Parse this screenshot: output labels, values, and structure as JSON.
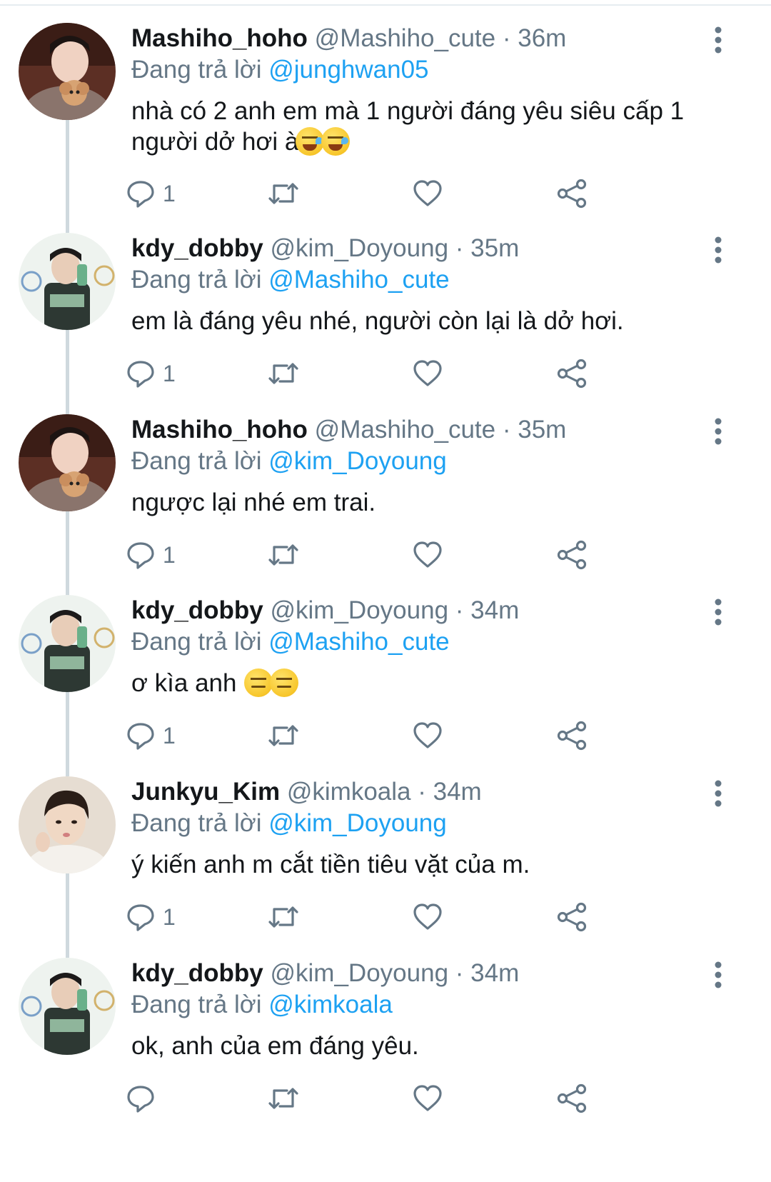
{
  "tweets": [
    {
      "display_name": "Mashiho_hoho",
      "handle": "@Mashiho_cute",
      "time": "· 36m",
      "reply_prefix": "Đang trả lời",
      "reply_to": "@junghwan05",
      "text": "nhà có 2 anh em mà 1 người đáng yêu siêu cấp 1 người dở hơi à",
      "emoji": [
        "rolling-on-floor-laughing",
        "rolling-on-floor-laughing"
      ],
      "reply_count": "1",
      "avatar": "mashiho-avatar"
    },
    {
      "display_name": "kdy_dobby",
      "handle": "@kim_Doyoung",
      "time": "· 35m",
      "reply_prefix": "Đang trả lời",
      "reply_to": "@Mashiho_cute",
      "text": "em là đáng yêu nhé, người còn lại là dở hơi.",
      "emoji": [],
      "reply_count": "1",
      "avatar": "doyoung-avatar"
    },
    {
      "display_name": "Mashiho_hoho",
      "handle": "@Mashiho_cute",
      "time": "· 35m",
      "reply_prefix": "Đang trả lời",
      "reply_to": "@kim_Doyoung",
      "text": "ngược lại nhé em trai.",
      "emoji": [],
      "reply_count": "1",
      "avatar": "mashiho-avatar"
    },
    {
      "display_name": "kdy_dobby",
      "handle": "@kim_Doyoung",
      "time": "· 34m",
      "reply_prefix": "Đang trả lời",
      "reply_to": "@Mashiho_cute",
      "text": "ơ kìa anh",
      "emoji": [
        "expressionless-face",
        "expressionless-face"
      ],
      "reply_count": "1",
      "avatar": "doyoung-avatar"
    },
    {
      "display_name": "Junkyu_Kim",
      "handle": "@kimkoala",
      "time": "· 34m",
      "reply_prefix": "Đang trả lời",
      "reply_to": "@kim_Doyoung",
      "text": "ý kiến anh m cắt tiền tiêu vặt của m.",
      "emoji": [],
      "reply_count": "1",
      "avatar": "junkyu-avatar"
    },
    {
      "display_name": "kdy_dobby",
      "handle": "@kim_Doyoung",
      "time": "· 34m",
      "reply_prefix": "Đang trả lời",
      "reply_to": "@kimkoala",
      "text": "ok, anh của em đáng yêu.",
      "emoji": [],
      "reply_count": "",
      "avatar": "doyoung-avatar"
    }
  ],
  "icons": {
    "reply": "reply-bubble-icon",
    "retweet": "retweet-icon",
    "like": "heart-icon",
    "share": "share-icon",
    "more": "more-vertical-icon"
  },
  "colors": {
    "text": "#14171a",
    "secondary": "#657786",
    "mention": "#1da1f2",
    "thread_line": "#cfd9de"
  }
}
